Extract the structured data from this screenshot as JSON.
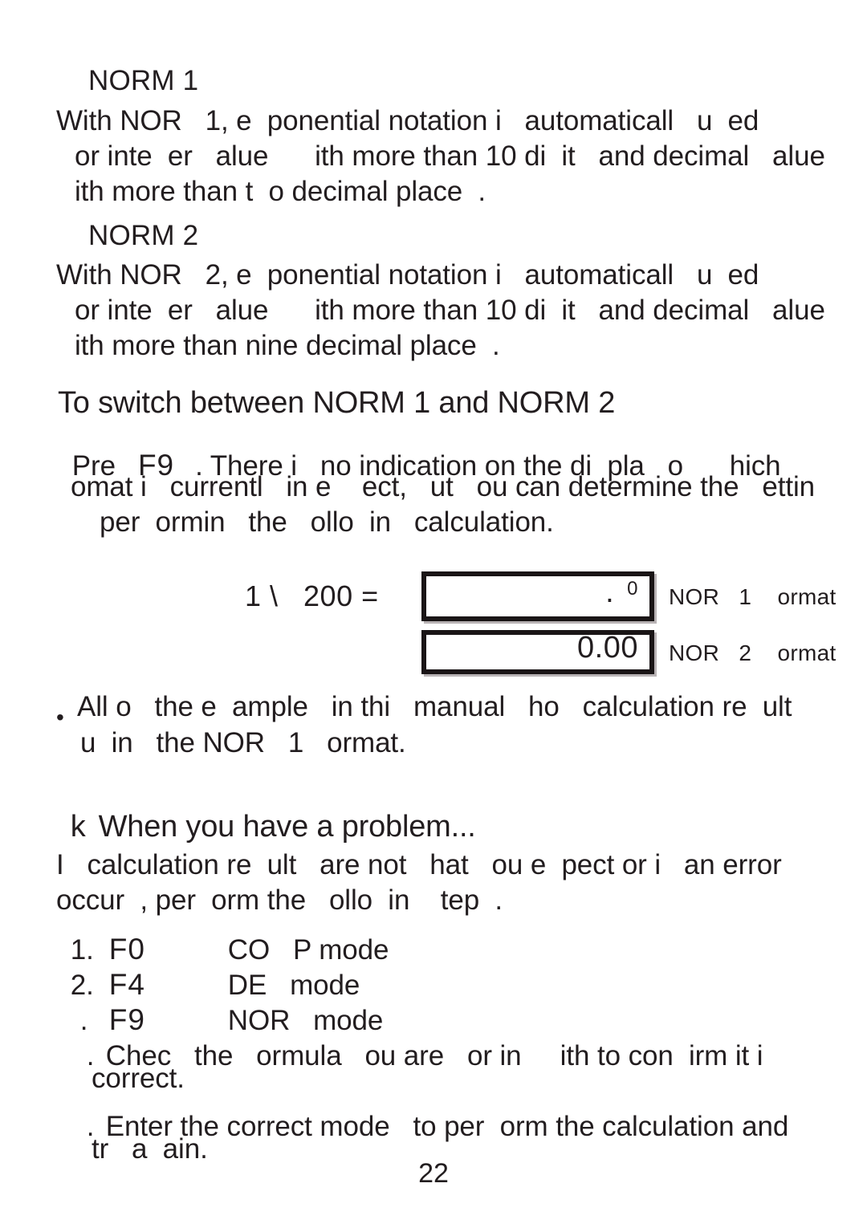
{
  "page": {
    "number": "22",
    "background": "#ffffff",
    "ink": "#221d1f"
  },
  "norm1": {
    "heading": "NORM 1",
    "lines": [
      "With NOR   1, e  ponential notation i   automaticall   u  ed",
      "or inte  er   alue      ith more than 10 di  it   and decimal   alue",
      "ith more than t  o decimal place  ."
    ]
  },
  "norm2": {
    "heading": "NORM 2",
    "lines": [
      "With NOR   2, e  ponential notation i   automaticall   u  ed",
      "or inte  er   alue      ith more than 10 di  it   and decimal   alue",
      "ith more than nine decimal place  ."
    ]
  },
  "switch_section": {
    "heading": "To switch between NORM 1 and NORM 2",
    "line1_pre": "Pre",
    "line1_key": "F9",
    "line1_post": ". There i   no indication on the di  pla   o      hich",
    "line2": "omat i   currentl   in e    ect,   ut   ou can determine the   ettin",
    "line3": "per  ormin   the   ollo  in   calculation."
  },
  "example": {
    "expression": "1 \\   200 =",
    "box1": {
      "decimal_point": ".",
      "exponent": "0",
      "label": "NOR   1    ormat"
    },
    "box2": {
      "value": "0.00",
      "label": "NOR   2    ormat"
    }
  },
  "note": {
    "bullet": "•",
    "lines": [
      "All o   the e  ample   in thi   manual   ho   calculation re  ult",
      "u  in   the NOR   1   ormat."
    ]
  },
  "problem_section": {
    "marker": "k",
    "heading": "When you have a problem...",
    "intro": [
      "I   calculation re  ult   are not   hat   ou e  pect or i   an error",
      "occur  , per  orm the   ollo  in    tep  ."
    ],
    "steps": [
      {
        "num": "1.",
        "key": "F0",
        "desc": "CO   P mode"
      },
      {
        "num": "2.",
        "key": "F4",
        "desc": "DE   mode"
      },
      {
        "num": ".",
        "key": "F9",
        "desc": "NOR   mode"
      }
    ],
    "sub_steps": [
      {
        "num": ".",
        "lines": [
          "Chec   the   ormula   ou are   or in     ith to con  irm it i",
          "correct."
        ]
      },
      {
        "num": ".",
        "lines": [
          "Enter the correct mode   to per  orm the calculation and",
          "tr   a  ain."
        ]
      }
    ]
  }
}
